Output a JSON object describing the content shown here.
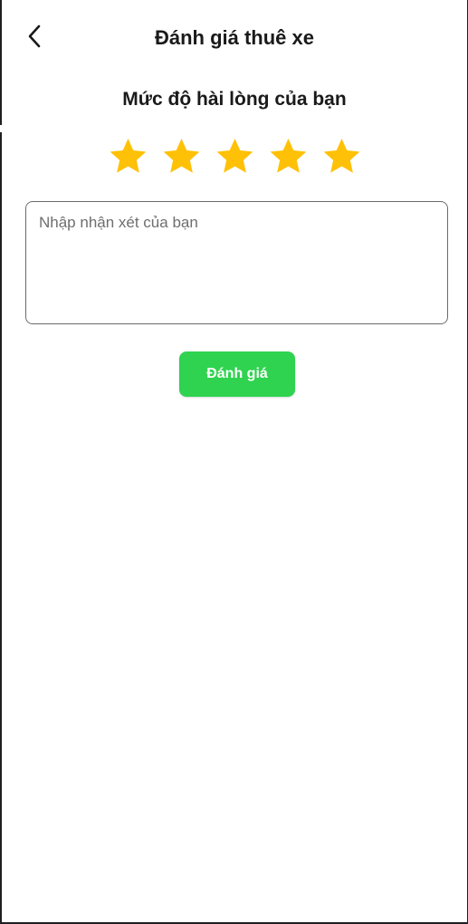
{
  "header": {
    "title": "Đánh giá thuê xe",
    "back_icon": "chevron-left-icon"
  },
  "rating": {
    "heading": "Mức độ hài lòng của bạn",
    "stars_filled": 5,
    "stars_total": 5,
    "star_color": "#FFC107"
  },
  "comment": {
    "placeholder": "Nhập nhận xét của bạn",
    "value": ""
  },
  "submit": {
    "label": "Đánh giá",
    "color": "#2FD34F"
  }
}
